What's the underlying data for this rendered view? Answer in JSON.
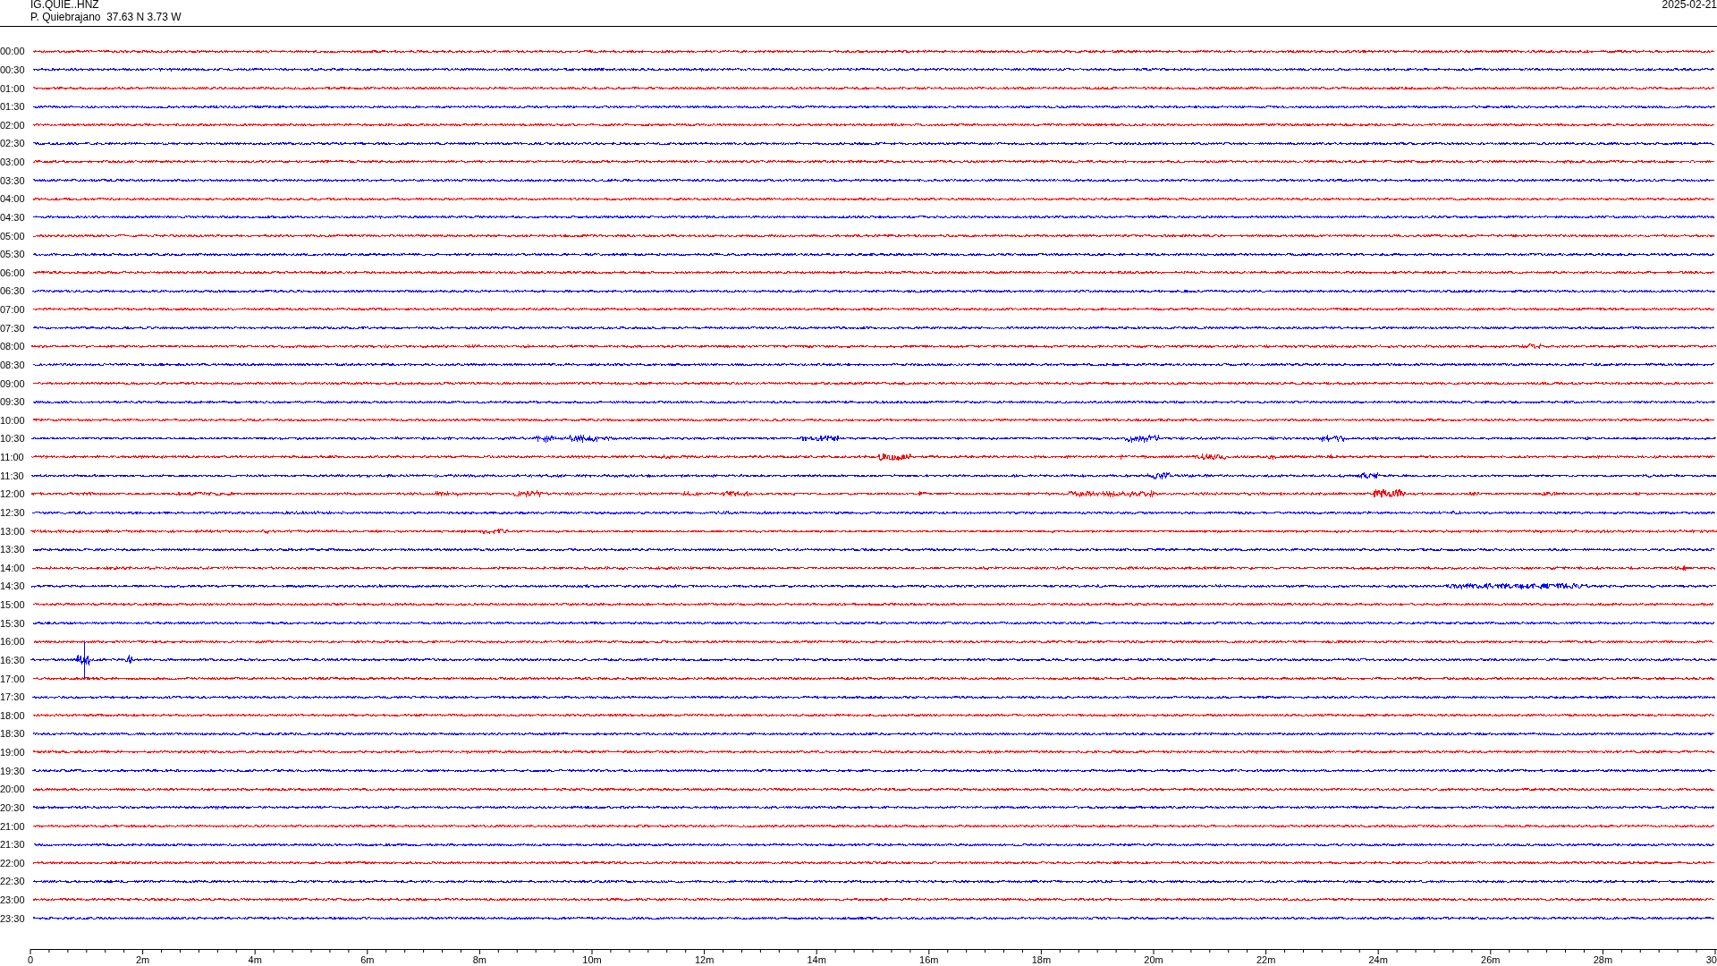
{
  "header": {
    "station": "IG.QUIE..HNZ",
    "location": "P. Quiebrajano  37.63 N 3.73 W",
    "date": "2025-02-21"
  },
  "traces": [
    {
      "label": "00:00",
      "color": "#ff0000"
    },
    {
      "label": "00:30",
      "color": "#0000ff"
    },
    {
      "label": "01:00",
      "color": "#ff0000"
    },
    {
      "label": "01:30",
      "color": "#0000ff"
    },
    {
      "label": "02:00",
      "color": "#ff0000"
    },
    {
      "label": "02:30",
      "color": "#0000ff"
    },
    {
      "label": "03:00",
      "color": "#ff0000"
    },
    {
      "label": "03:30",
      "color": "#0000ff"
    },
    {
      "label": "04:00",
      "color": "#ff0000"
    },
    {
      "label": "04:30",
      "color": "#0000ff"
    },
    {
      "label": "05:00",
      "color": "#ff0000"
    },
    {
      "label": "05:30",
      "color": "#0000ff"
    },
    {
      "label": "06:00",
      "color": "#ff0000"
    },
    {
      "label": "06:30",
      "color": "#0000ff"
    },
    {
      "label": "07:00",
      "color": "#ff0000"
    },
    {
      "label": "07:30",
      "color": "#0000ff"
    },
    {
      "label": "08:00",
      "color": "#ff0000"
    },
    {
      "label": "08:30",
      "color": "#0000ff"
    },
    {
      "label": "09:00",
      "color": "#ff0000"
    },
    {
      "label": "09:30",
      "color": "#0000ff"
    },
    {
      "label": "10:00",
      "color": "#ff0000"
    },
    {
      "label": "10:30",
      "color": "#0000ff"
    },
    {
      "label": "11:00",
      "color": "#ff0000"
    },
    {
      "label": "11:30",
      "color": "#0000ff"
    },
    {
      "label": "12:00",
      "color": "#ff0000"
    },
    {
      "label": "12:30",
      "color": "#0000ff"
    },
    {
      "label": "13:00",
      "color": "#ff0000"
    },
    {
      "label": "13:30",
      "color": "#0000ff"
    },
    {
      "label": "14:00",
      "color": "#ff0000"
    },
    {
      "label": "14:30",
      "color": "#0000ff"
    },
    {
      "label": "15:00",
      "color": "#ff0000"
    },
    {
      "label": "15:30",
      "color": "#0000ff"
    },
    {
      "label": "16:00",
      "color": "#ff0000"
    },
    {
      "label": "16:30",
      "color": "#0000ff"
    },
    {
      "label": "17:00",
      "color": "#ff0000"
    },
    {
      "label": "17:30",
      "color": "#0000ff"
    },
    {
      "label": "18:00",
      "color": "#ff0000"
    },
    {
      "label": "18:30",
      "color": "#0000ff"
    },
    {
      "label": "19:00",
      "color": "#ff0000"
    },
    {
      "label": "19:30",
      "color": "#0000ff"
    },
    {
      "label": "20:00",
      "color": "#ff0000"
    },
    {
      "label": "20:30",
      "color": "#0000ff"
    },
    {
      "label": "21:00",
      "color": "#ff0000"
    },
    {
      "label": "21:30",
      "color": "#0000ff"
    },
    {
      "label": "22:00",
      "color": "#ff0000"
    },
    {
      "label": "22:30",
      "color": "#0000ff"
    },
    {
      "label": "23:00",
      "color": "#ff0000"
    },
    {
      "label": "23:30",
      "color": "#0000ff"
    }
  ],
  "x_axis": {
    "ticks": [
      "0",
      "2m",
      "4m",
      "6m",
      "8m",
      "10m",
      "12m",
      "14m",
      "16m",
      "18m",
      "20m",
      "22m",
      "24m",
      "26m",
      "28m",
      "30"
    ]
  }
}
